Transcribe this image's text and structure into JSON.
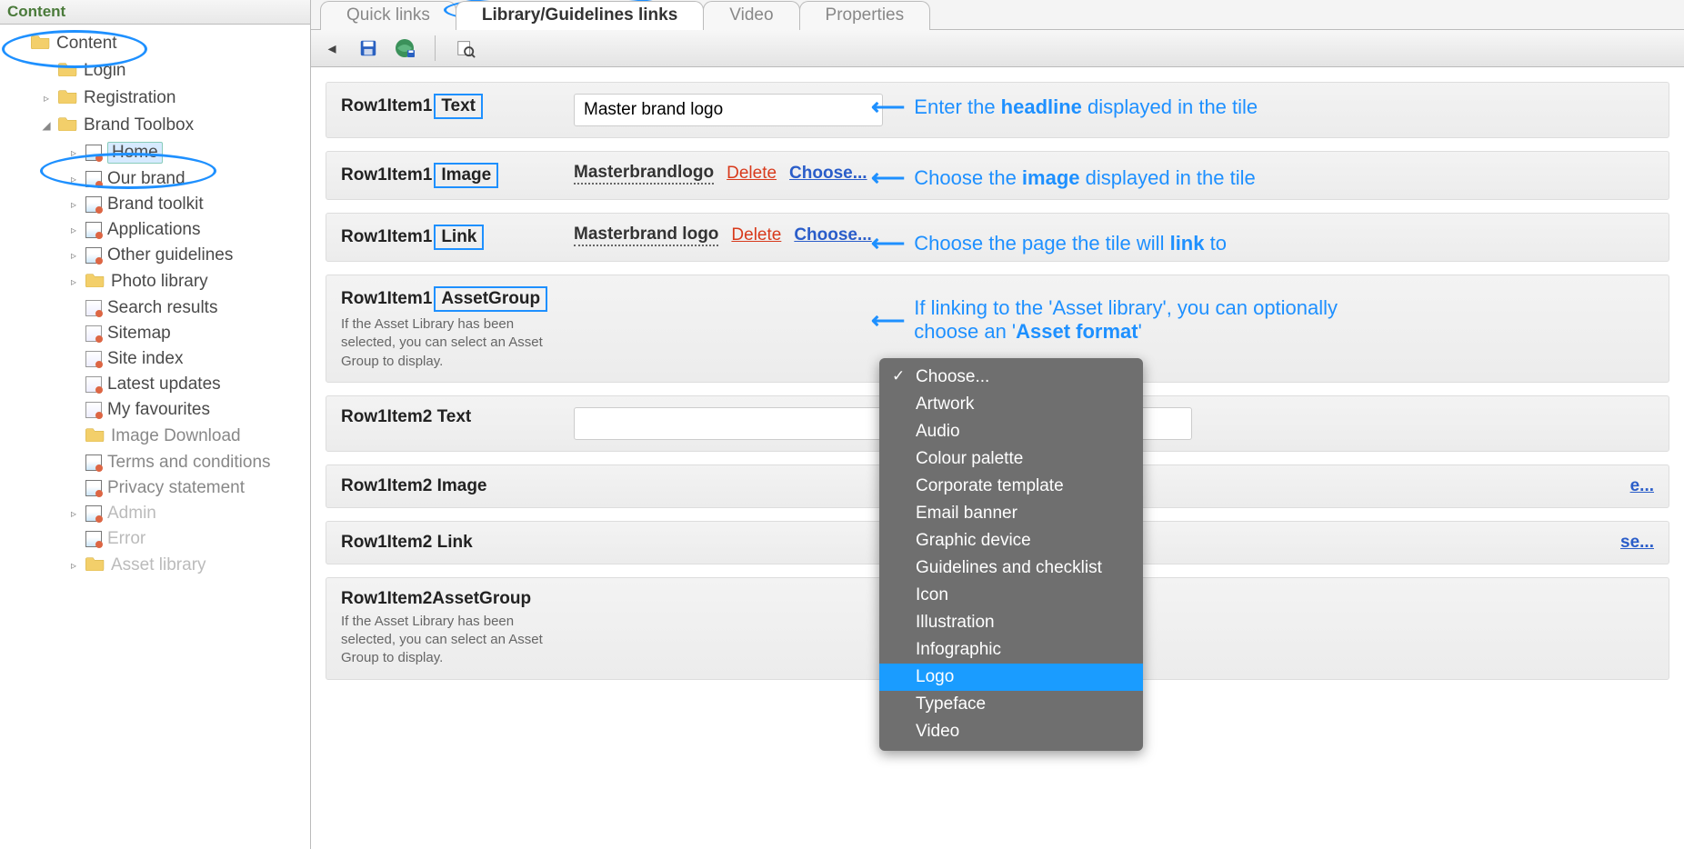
{
  "sidebar": {
    "header": "Content",
    "nodes": [
      {
        "label": "Content",
        "icon": "folder",
        "indent": 0,
        "exp": ""
      },
      {
        "label": "Login",
        "icon": "folder",
        "indent": 1,
        "exp": ""
      },
      {
        "label": "Registration",
        "icon": "folder",
        "indent": 2,
        "exp": "▹"
      },
      {
        "label": "Brand Toolbox",
        "icon": "folder",
        "indent": 2,
        "exp": "◢"
      },
      {
        "label": "Home",
        "icon": "page",
        "indent": 3,
        "exp": "▹",
        "sel": true
      },
      {
        "label": "Our brand",
        "icon": "page",
        "indent": 3,
        "exp": "▹"
      },
      {
        "label": "Brand toolkit",
        "icon": "page",
        "indent": 3,
        "exp": "▹"
      },
      {
        "label": "Applications",
        "icon": "page",
        "indent": 3,
        "exp": "▹"
      },
      {
        "label": "Other guidelines",
        "icon": "page",
        "indent": 3,
        "exp": "▹"
      },
      {
        "label": "Photo library",
        "icon": "folder",
        "indent": 3,
        "exp": "▹"
      },
      {
        "label": "Search results",
        "icon": "doc",
        "indent": 3,
        "exp": ""
      },
      {
        "label": "Sitemap",
        "icon": "doc",
        "indent": 3,
        "exp": ""
      },
      {
        "label": "Site index",
        "icon": "doc",
        "indent": 3,
        "exp": ""
      },
      {
        "label": "Latest updates",
        "icon": "doc",
        "indent": 3,
        "exp": ""
      },
      {
        "label": "My favourites",
        "icon": "doc",
        "indent": 3,
        "exp": ""
      },
      {
        "label": "Image Download",
        "icon": "folder",
        "indent": 3,
        "exp": "",
        "dim": true
      },
      {
        "label": "Terms and conditions",
        "icon": "page",
        "indent": 3,
        "exp": "",
        "dim": true
      },
      {
        "label": "Privacy statement",
        "icon": "page",
        "indent": 3,
        "exp": "",
        "dim": true
      },
      {
        "label": "Admin",
        "icon": "page",
        "indent": 3,
        "exp": "▹",
        "muted": true
      },
      {
        "label": "Error",
        "icon": "page",
        "indent": 3,
        "exp": "",
        "muted": true
      },
      {
        "label": "Asset library",
        "icon": "folder",
        "indent": 3,
        "exp": "▹",
        "muted": true
      }
    ]
  },
  "tabs": [
    {
      "label": "Quick links",
      "active": false
    },
    {
      "label": "Library/Guidelines links",
      "active": true
    },
    {
      "label": "Video",
      "active": false
    },
    {
      "label": "Properties",
      "active": false
    }
  ],
  "rows": {
    "r1text": {
      "prefix": "Row1Item1",
      "boxed": "Text",
      "value": "Master brand logo"
    },
    "r1image": {
      "prefix": "Row1Item1",
      "boxed": "Image",
      "value": "Masterbrandlogo",
      "del": "Delete",
      "choose": "Choose..."
    },
    "r1link": {
      "prefix": "Row1Item1",
      "boxed": "Link",
      "value": "Masterbrand logo",
      "del": "Delete",
      "choose": "Choose..."
    },
    "r1asset": {
      "prefix": "Row1Item1",
      "boxed": "AssetGroup",
      "help": "If the Asset Library has been selected, you can select an Asset Group to display."
    },
    "r2text": {
      "label": "Row1Item2 Text"
    },
    "r2image": {
      "label": "Row1Item2 Image",
      "choose": "e..."
    },
    "r2link": {
      "label": "Row1Item2 Link",
      "choose": "se..."
    },
    "r2asset": {
      "label": "Row1Item2AssetGroup",
      "help": "If the Asset Library has been selected, you can select an Asset Group to display."
    }
  },
  "dropdown": {
    "items": [
      {
        "label": "Choose...",
        "check": true
      },
      {
        "label": "Artwork"
      },
      {
        "label": "Audio"
      },
      {
        "label": "Colour palette"
      },
      {
        "label": "Corporate template"
      },
      {
        "label": "Email banner"
      },
      {
        "label": "Graphic device"
      },
      {
        "label": "Guidelines and checklist"
      },
      {
        "label": "Icon"
      },
      {
        "label": "Illustration"
      },
      {
        "label": "Infographic"
      },
      {
        "label": "Logo",
        "hl": true
      },
      {
        "label": "Typeface"
      },
      {
        "label": "Video"
      }
    ]
  },
  "callouts": {
    "c1_a": "Enter the ",
    "c1_b": "headline",
    "c1_c": " displayed in the tile",
    "c2_a": "Choose the ",
    "c2_b": "image",
    "c2_c": " displayed in the tile",
    "c3_a": "Choose the page the tile will ",
    "c3_b": "link",
    "c3_c": " to",
    "c4_a": "If linking to the 'Asset library', you can optionally choose an '",
    "c4_b": "Asset format",
    "c4_c": "'"
  }
}
